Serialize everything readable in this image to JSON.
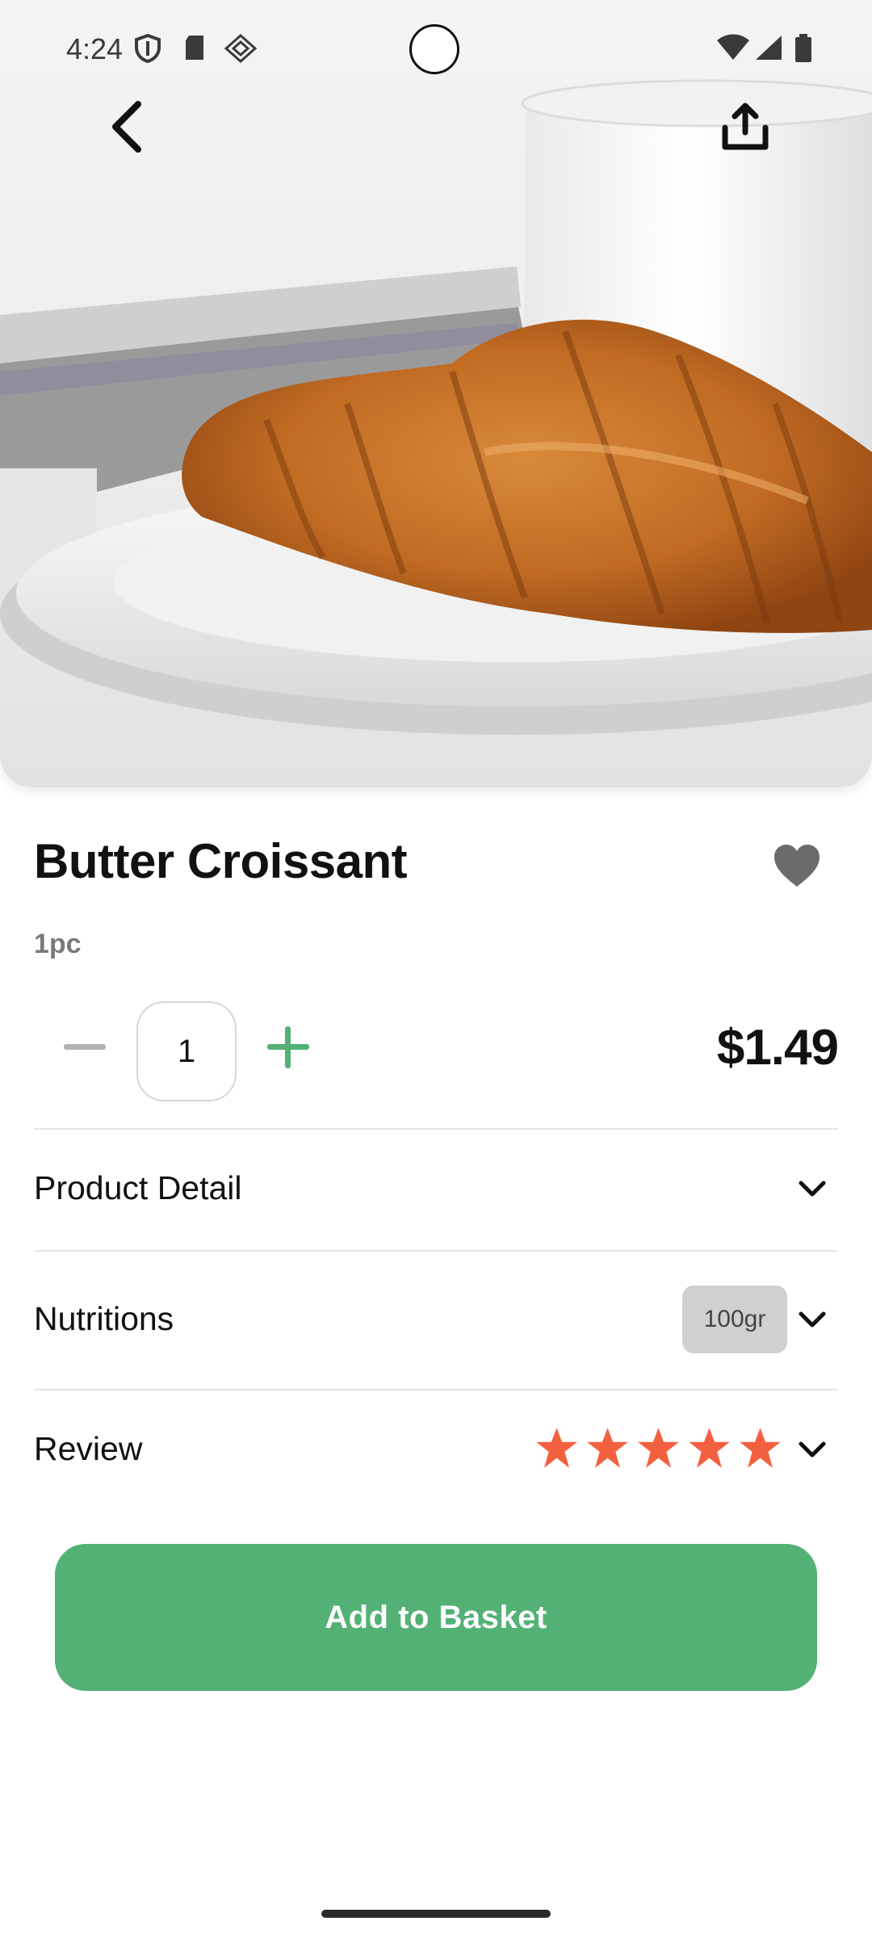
{
  "status_bar": {
    "time": "4:24",
    "icons": [
      "shield-icon",
      "sd-card-icon",
      "diamond-icon",
      "wifi-icon",
      "signal-icon",
      "battery-icon"
    ]
  },
  "nav": {
    "back_icon": "chevron-left-icon",
    "share_icon": "share-upload-icon"
  },
  "product": {
    "name": "Butter Croissant",
    "unit": "1pc",
    "quantity": "1",
    "price": "$1.49",
    "favorite_icon": "heart-icon"
  },
  "sections": {
    "detail_label": "Product Detail",
    "nutrition_label": "Nutritions",
    "nutrition_badge": "100gr",
    "review_label": "Review",
    "review_rating": 5,
    "review_max": 5
  },
  "cta": {
    "label": "Add to Basket"
  },
  "colors": {
    "accent": "#53b175",
    "star": "#f3603f",
    "price": "#111111",
    "muted": "#7b7b7b"
  }
}
